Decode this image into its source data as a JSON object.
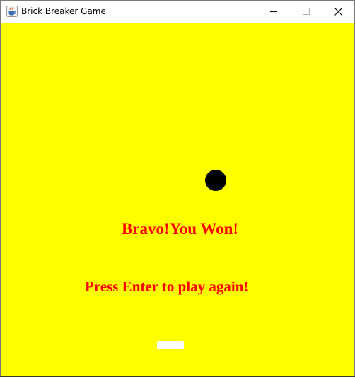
{
  "window": {
    "title": "Brick Breaker Game",
    "app_icon": "java-cup-icon",
    "controls": {
      "minimize_icon": "minimize-icon",
      "maximize_icon": "maximize-icon",
      "close_icon": "close-icon"
    }
  },
  "game": {
    "background_color": "#ffff00",
    "ball_color": "#000000",
    "paddle_color": "#ffffff",
    "message_color": "#ff0000",
    "win_message": "Bravo!You Won!",
    "restart_prompt": "Press Enter to play again!"
  }
}
